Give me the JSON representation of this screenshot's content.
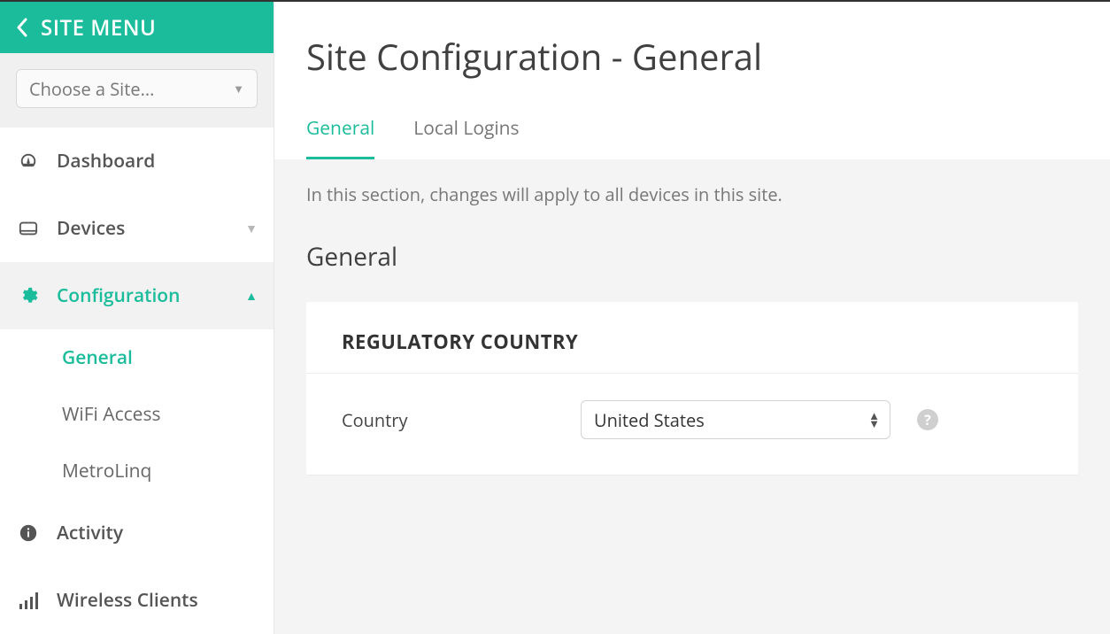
{
  "sidebar": {
    "title": "SITE MENU",
    "site_selector_label": "Choose a Site...",
    "items": [
      {
        "label": "Dashboard"
      },
      {
        "label": "Devices"
      },
      {
        "label": "Configuration"
      },
      {
        "label": "Activity"
      },
      {
        "label": "Wireless Clients"
      }
    ],
    "config_submenu": [
      {
        "label": "General"
      },
      {
        "label": "WiFi Access"
      },
      {
        "label": "MetroLinq"
      }
    ]
  },
  "main": {
    "title": "Site Configuration - General",
    "tabs": [
      {
        "label": "General"
      },
      {
        "label": "Local Logins"
      }
    ],
    "description": "In this section, changes will apply to all devices in this site.",
    "section_heading": "General",
    "card": {
      "title": "REGULATORY COUNTRY",
      "field_label": "Country",
      "selected": "United States"
    }
  }
}
